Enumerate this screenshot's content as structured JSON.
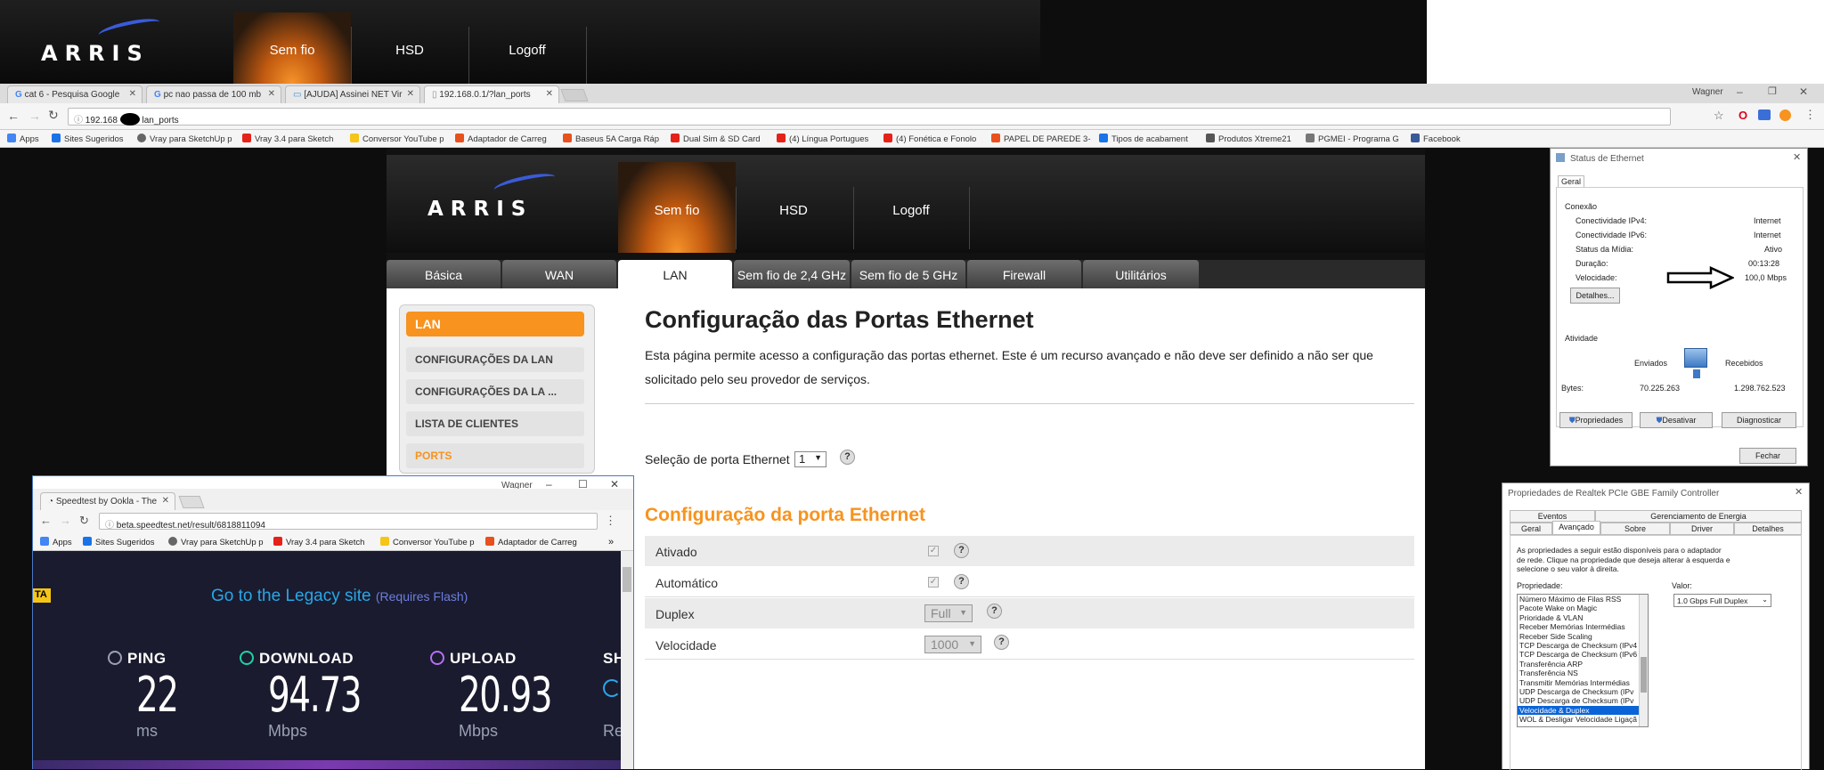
{
  "top_banner": {
    "logo": "ARRIS",
    "tabs": [
      {
        "label": "Sem fio",
        "active": true
      },
      {
        "label": "HSD",
        "active": false
      },
      {
        "label": "Logoff",
        "active": false
      }
    ]
  },
  "browser": {
    "tabs": [
      {
        "label": "cat 6 - Pesquisa Google",
        "icon": "google-icon"
      },
      {
        "label": "pc nao passa de 100 mb",
        "icon": "google-icon"
      },
      {
        "label": "[AJUDA] Assinei NET Vir",
        "icon": "forum-icon"
      },
      {
        "label": "192.168.0.1/?lan_ports",
        "icon": "page-icon",
        "active": true
      }
    ],
    "profile_name": "Wagner",
    "url_prefix": "192.168",
    "url_suffix": "lan_ports",
    "bookmarks": [
      {
        "label": "Apps",
        "color": "#4285f4"
      },
      {
        "label": "Sites Sugeridos",
        "color": "#1a73e8"
      },
      {
        "label": "Vray para SketchUp p",
        "color": "#666"
      },
      {
        "label": "Vray 3.4 para Sketch",
        "color": "#e62117"
      },
      {
        "label": "Conversor YouTube p",
        "color": "#f5c518"
      },
      {
        "label": "Adaptador de Carreg",
        "color": "#e8501e"
      },
      {
        "label": "Baseus 5A Carga Ráp",
        "color": "#e8501e"
      },
      {
        "label": "Dual Sim & SD Card",
        "color": "#e62117"
      },
      {
        "label": "(4) Língua Portugues",
        "color": "#e62117"
      },
      {
        "label": "(4) Fonética e Fonolo",
        "color": "#e62117"
      },
      {
        "label": "PAPEL DE PAREDE 3-",
        "color": "#e8501e"
      },
      {
        "label": "Tipos de acabament",
        "color": "#1a73e8"
      },
      {
        "label": "Produtos Xtreme21",
        "color": "#555"
      },
      {
        "label": "PGMEI - Programa G",
        "color": "#777"
      },
      {
        "label": "Facebook",
        "color": "#3b5998"
      }
    ]
  },
  "arris": {
    "logo": "ARRIS",
    "header_tabs": [
      {
        "label": "Sem fio",
        "active": true
      },
      {
        "label": "HSD"
      },
      {
        "label": "Logoff"
      }
    ],
    "sub_tabs": [
      {
        "label": "Básica"
      },
      {
        "label": "WAN"
      },
      {
        "label": "LAN",
        "active": true
      },
      {
        "label": "Sem fio de 2,4 GHz"
      },
      {
        "label": "Sem fio de 5 GHz"
      },
      {
        "label": "Firewall"
      },
      {
        "label": "Utilitários"
      }
    ],
    "sidebar": {
      "header": "LAN",
      "items": [
        {
          "label": "CONFIGURAÇÕES DA LAN"
        },
        {
          "label": "CONFIGURAÇÕES DA LA ..."
        },
        {
          "label": "LISTA DE CLIENTES"
        },
        {
          "label": "PORTS",
          "selected": true
        }
      ]
    },
    "title": "Configuração das Portas Ethernet",
    "description": "Esta página permite acesso a configuração das portas ethernet. Este é um recurso avançado e não deve ser definido a não ser que solicitado pelo seu provedor de serviços.",
    "port_select_label": "Seleção de porta Ethernet",
    "port_select_value": "1",
    "section_title": "Configuração da porta Ethernet",
    "rows": [
      {
        "label": "Ativado",
        "kind": "checkbox",
        "checked": true
      },
      {
        "label": "Automático",
        "kind": "checkbox",
        "checked": true
      },
      {
        "label": "Duplex",
        "kind": "select",
        "value": "Full"
      },
      {
        "label": "Velocidade",
        "kind": "select",
        "value": "1000"
      }
    ],
    "help": "?"
  },
  "speedtest": {
    "tab_label": "Speedtest by Ookla - The",
    "profile_name": "Wagner",
    "url": "beta.speedtest.net/result/6818811094",
    "bookmarks": [
      "Apps",
      "Sites Sugeridos",
      "Vray para SketchUp p",
      "Vray 3.4 para Sketch",
      "Conversor YouTube p",
      "Adaptador de Carreg"
    ],
    "badge": "TA",
    "legacy_link": "Go to the Legacy site",
    "legacy_note": "(Requires Flash)",
    "metrics": [
      {
        "label": "PING",
        "value": "22",
        "unit": "ms",
        "color": "#9aa0b5"
      },
      {
        "label": "DOWNLOAD",
        "value": "94.73",
        "unit": "Mbps",
        "color": "#1fd1a5"
      },
      {
        "label": "UPLOAD",
        "value": "20.93",
        "unit": "Mbps",
        "color": "#b56ff5"
      },
      {
        "label": "SH",
        "value": "",
        "unit": "Re",
        "color": "#28a7e8"
      }
    ]
  },
  "ethernet_status": {
    "title": "Status de Ethernet",
    "tab": "Geral",
    "connection_label": "Conexão",
    "rows": [
      {
        "k": "Conectividade IPv4:",
        "v": "Internet"
      },
      {
        "k": "Conectividade IPv6:",
        "v": "Internet"
      },
      {
        "k": "Status da Mídia:",
        "v": "Ativo"
      },
      {
        "k": "Duração:",
        "v": "00:13:28"
      },
      {
        "k": "Velocidade:",
        "v": "100,0 Mbps"
      }
    ],
    "details_button": "Detalhes...",
    "activity_label": "Atividade",
    "sent_label": "Enviados",
    "received_label": "Recebidos",
    "bytes_label": "Bytes:",
    "bytes_sent": "70.225.263",
    "bytes_received": "1.298.762.523",
    "buttons": [
      "Propriedades",
      "Desativar",
      "Diagnosticar"
    ],
    "close_button": "Fechar"
  },
  "realtek_props": {
    "title": "Propriedades de Realtek PCIe GBE Family Controller",
    "tabs_row1": [
      "Eventos",
      "Gerenciamento de Energia"
    ],
    "tabs_row2": [
      {
        "label": "Geral"
      },
      {
        "label": "Avançado",
        "active": true
      },
      {
        "label": "Sobre"
      },
      {
        "label": "Driver"
      },
      {
        "label": "Detalhes"
      }
    ],
    "description": "As propriedades a seguir estão disponíveis para o adaptador de rede. Clique na propriedade que deseja alterar à esquerda e selecione o seu valor à direita.",
    "property_label": "Propriedade:",
    "value_label": "Valor:",
    "value": "1.0 Gbps Full Duplex",
    "properties": [
      {
        "label": "Número Máximo de Filas RSS"
      },
      {
        "label": "Pacote Wake on Magic"
      },
      {
        "label": "Prioridade & VLAN"
      },
      {
        "label": "Receber Memórias Intermédias"
      },
      {
        "label": "Receber Side Scaling"
      },
      {
        "label": "TCP Descarga de Checksum (IPv4"
      },
      {
        "label": "TCP Descarga de Checksum (IPv6"
      },
      {
        "label": "Transferência ARP"
      },
      {
        "label": "Transferência NS"
      },
      {
        "label": "Transmitir Memórias Intermédias"
      },
      {
        "label": "UDP Descarga de Checksum (IPv"
      },
      {
        "label": "UDP Descarga de Checksum (IPv"
      },
      {
        "label": "Velocidade & Duplex",
        "selected": true
      },
      {
        "label": "WOL & Desligar Velocidade Ligaçã"
      }
    ]
  },
  "colors": {
    "arris_orange": "#f7931e",
    "speedtest_bg": "#1a1b2e",
    "legacy_link": "#28a7e8",
    "selection_blue": "#0a64d8"
  }
}
